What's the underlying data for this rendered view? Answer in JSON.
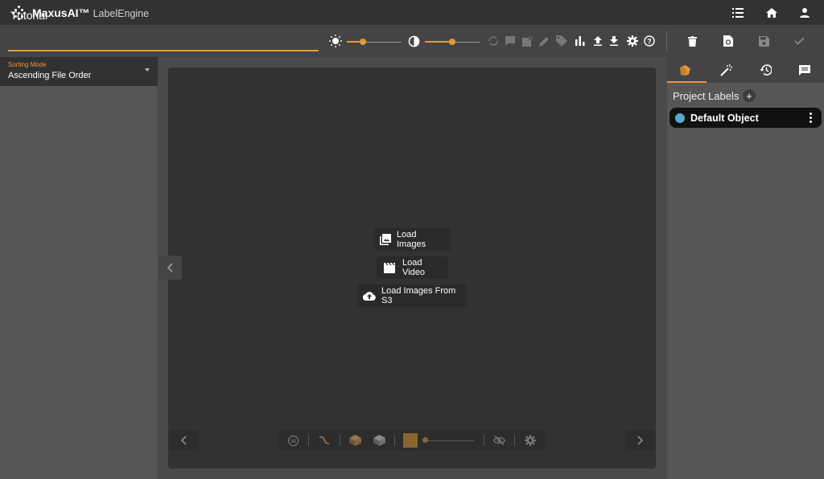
{
  "app": {
    "brand_name": "MaxusAI™",
    "brand_product": "LabelEngine"
  },
  "toolbar": {
    "project_title": "Tutorial",
    "brightness_level": 0.3,
    "contrast_level": 0.5
  },
  "sidebar": {
    "sorting_mode_label": "Sorting Mode",
    "sorting_mode_value": "Ascending File Order"
  },
  "canvas": {
    "load_images_label": "Load Images",
    "load_video_label": "Load Video",
    "load_s3_label": "Load Images From S3",
    "opacity_level": 0.05,
    "selected_color": "#8a6530"
  },
  "right_panel": {
    "project_labels_title": "Project Labels",
    "add_symbol": "+",
    "labels": [
      {
        "name": "Default Object",
        "color": "#58a9cf"
      }
    ]
  },
  "colors": {
    "accent": "#e49a3a",
    "topbar_bg": "#323232",
    "canvas_bg": "#323232"
  }
}
